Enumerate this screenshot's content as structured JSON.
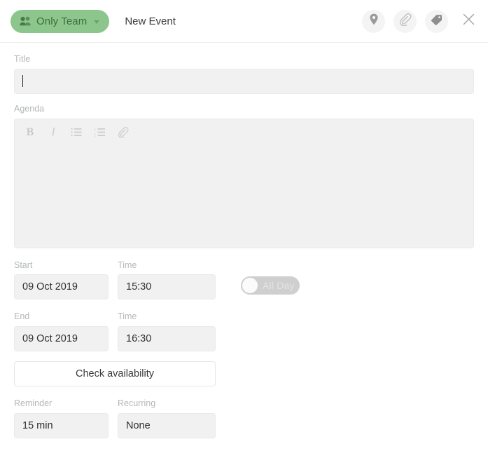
{
  "header": {
    "audience": {
      "label": "Only Team",
      "icon": "people-icon",
      "caret": "chevron-down-icon",
      "color": "#8dc68d",
      "text_color": "#3f6b3f"
    },
    "title": "New Event",
    "actions": [
      {
        "name": "location-icon",
        "title": "Location"
      },
      {
        "name": "attachment-icon",
        "title": "Attachment"
      },
      {
        "name": "tag-icon",
        "title": "Tag"
      }
    ],
    "close": {
      "name": "close-icon",
      "title": "Close"
    }
  },
  "form": {
    "title": {
      "label": "Title",
      "value": "",
      "placeholder": ""
    },
    "agenda": {
      "label": "Agenda",
      "value": "",
      "toolbar": [
        {
          "name": "bold-icon",
          "label": "B"
        },
        {
          "name": "italic-icon",
          "label": "I"
        },
        {
          "name": "bullet-list-icon",
          "label": ""
        },
        {
          "name": "numbered-list-icon",
          "label": ""
        },
        {
          "name": "attachment-icon",
          "label": ""
        }
      ]
    },
    "start": {
      "date_label": "Start",
      "date_value": "09 Oct 2019",
      "time_label": "Time",
      "time_value": "15:30"
    },
    "all_day": {
      "label": "All Day",
      "enabled": false
    },
    "end": {
      "date_label": "End",
      "date_value": "09 Oct 2019",
      "time_label": "Time",
      "time_value": "16:30"
    },
    "check_availability": {
      "label": "Check availability"
    },
    "reminder": {
      "label": "Reminder",
      "value": "15 min"
    },
    "recurring": {
      "label": "Recurring",
      "value": "None"
    }
  }
}
